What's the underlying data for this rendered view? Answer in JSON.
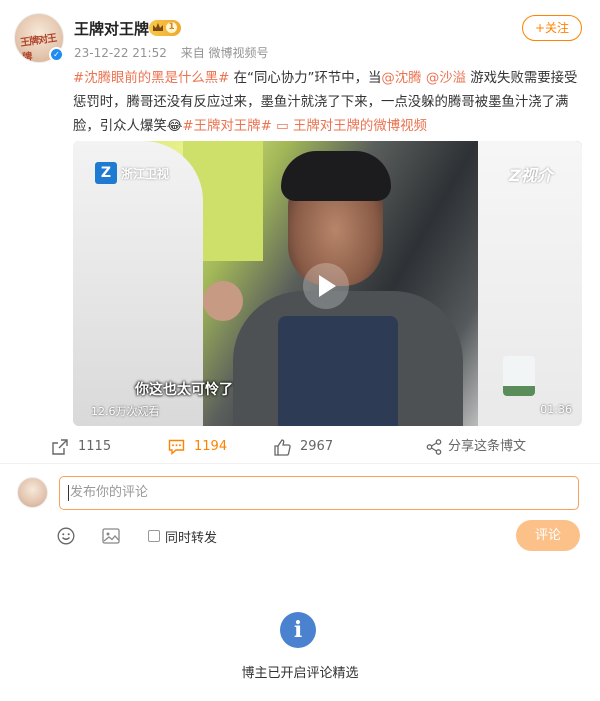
{
  "author": {
    "name": "王牌对王牌",
    "crown_level": "1",
    "verified": true,
    "avatar_caption": "王牌对王牌"
  },
  "meta": {
    "time": "23-12-22 21:52",
    "source": "来自 微博视频号"
  },
  "follow_label": "+关注",
  "post": {
    "segments": [
      {
        "text": "#沈腾眼前的黑是什么黑#",
        "style": "topic"
      },
      {
        "text": " 在“同心协力”环节中，当",
        "style": "plain"
      },
      {
        "text": "@沈腾",
        "style": "mention"
      },
      {
        "text": " ",
        "style": "plain"
      },
      {
        "text": "@沙溢",
        "style": "mention"
      },
      {
        "text": " 游戏失败需要接受惩罚时，腾哥还没有反应过来，墨鱼汁就浇了下来，一点没躲的腾哥被墨鱼汁浇了满脸，引众人爆笑",
        "style": "plain"
      },
      {
        "text": "😂",
        "style": "emoji"
      },
      {
        "text": "#王牌对王牌#",
        "style": "topic"
      },
      {
        "text": " ",
        "style": "plain"
      },
      {
        "text": "王牌对王牌的微博视频",
        "style": "video-link"
      }
    ]
  },
  "video": {
    "channel_logo": "浙江卫视",
    "corner_logo": "Z视介",
    "subtitle": "你这也太可怜了",
    "views": "12.6万次观看",
    "duration": "01:36"
  },
  "actions": {
    "repost_count": "1115",
    "comment_count": "1194",
    "like_count": "2967",
    "share_label": "分享这条博文"
  },
  "composer": {
    "placeholder": "发布你的评论",
    "repost_label": "同时转发",
    "submit_label": "评论"
  },
  "notice": {
    "text": "博主已开启评论精选"
  },
  "colors": {
    "accent": "#ff8200",
    "link": "#eb7350",
    "info": "#4a82d0"
  }
}
